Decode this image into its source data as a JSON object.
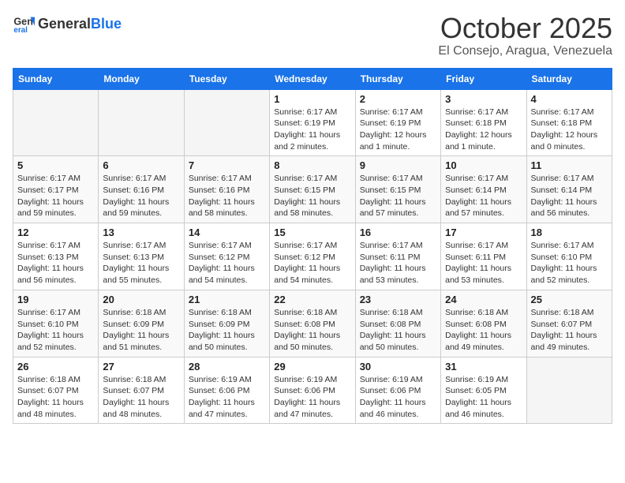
{
  "header": {
    "logo_general": "General",
    "logo_blue": "Blue",
    "month": "October 2025",
    "location": "El Consejo, Aragua, Venezuela"
  },
  "weekdays": [
    "Sunday",
    "Monday",
    "Tuesday",
    "Wednesday",
    "Thursday",
    "Friday",
    "Saturday"
  ],
  "weeks": [
    [
      {
        "day": "",
        "info": ""
      },
      {
        "day": "",
        "info": ""
      },
      {
        "day": "",
        "info": ""
      },
      {
        "day": "1",
        "info": "Sunrise: 6:17 AM\nSunset: 6:19 PM\nDaylight: 11 hours and 2 minutes."
      },
      {
        "day": "2",
        "info": "Sunrise: 6:17 AM\nSunset: 6:19 PM\nDaylight: 12 hours and 1 minute."
      },
      {
        "day": "3",
        "info": "Sunrise: 6:17 AM\nSunset: 6:18 PM\nDaylight: 12 hours and 1 minute."
      },
      {
        "day": "4",
        "info": "Sunrise: 6:17 AM\nSunset: 6:18 PM\nDaylight: 12 hours and 0 minutes."
      }
    ],
    [
      {
        "day": "5",
        "info": "Sunrise: 6:17 AM\nSunset: 6:17 PM\nDaylight: 11 hours and 59 minutes."
      },
      {
        "day": "6",
        "info": "Sunrise: 6:17 AM\nSunset: 6:16 PM\nDaylight: 11 hours and 59 minutes."
      },
      {
        "day": "7",
        "info": "Sunrise: 6:17 AM\nSunset: 6:16 PM\nDaylight: 11 hours and 58 minutes."
      },
      {
        "day": "8",
        "info": "Sunrise: 6:17 AM\nSunset: 6:15 PM\nDaylight: 11 hours and 58 minutes."
      },
      {
        "day": "9",
        "info": "Sunrise: 6:17 AM\nSunset: 6:15 PM\nDaylight: 11 hours and 57 minutes."
      },
      {
        "day": "10",
        "info": "Sunrise: 6:17 AM\nSunset: 6:14 PM\nDaylight: 11 hours and 57 minutes."
      },
      {
        "day": "11",
        "info": "Sunrise: 6:17 AM\nSunset: 6:14 PM\nDaylight: 11 hours and 56 minutes."
      }
    ],
    [
      {
        "day": "12",
        "info": "Sunrise: 6:17 AM\nSunset: 6:13 PM\nDaylight: 11 hours and 56 minutes."
      },
      {
        "day": "13",
        "info": "Sunrise: 6:17 AM\nSunset: 6:13 PM\nDaylight: 11 hours and 55 minutes."
      },
      {
        "day": "14",
        "info": "Sunrise: 6:17 AM\nSunset: 6:12 PM\nDaylight: 11 hours and 54 minutes."
      },
      {
        "day": "15",
        "info": "Sunrise: 6:17 AM\nSunset: 6:12 PM\nDaylight: 11 hours and 54 minutes."
      },
      {
        "day": "16",
        "info": "Sunrise: 6:17 AM\nSunset: 6:11 PM\nDaylight: 11 hours and 53 minutes."
      },
      {
        "day": "17",
        "info": "Sunrise: 6:17 AM\nSunset: 6:11 PM\nDaylight: 11 hours and 53 minutes."
      },
      {
        "day": "18",
        "info": "Sunrise: 6:17 AM\nSunset: 6:10 PM\nDaylight: 11 hours and 52 minutes."
      }
    ],
    [
      {
        "day": "19",
        "info": "Sunrise: 6:17 AM\nSunset: 6:10 PM\nDaylight: 11 hours and 52 minutes."
      },
      {
        "day": "20",
        "info": "Sunrise: 6:18 AM\nSunset: 6:09 PM\nDaylight: 11 hours and 51 minutes."
      },
      {
        "day": "21",
        "info": "Sunrise: 6:18 AM\nSunset: 6:09 PM\nDaylight: 11 hours and 50 minutes."
      },
      {
        "day": "22",
        "info": "Sunrise: 6:18 AM\nSunset: 6:08 PM\nDaylight: 11 hours and 50 minutes."
      },
      {
        "day": "23",
        "info": "Sunrise: 6:18 AM\nSunset: 6:08 PM\nDaylight: 11 hours and 50 minutes."
      },
      {
        "day": "24",
        "info": "Sunrise: 6:18 AM\nSunset: 6:08 PM\nDaylight: 11 hours and 49 minutes."
      },
      {
        "day": "25",
        "info": "Sunrise: 6:18 AM\nSunset: 6:07 PM\nDaylight: 11 hours and 49 minutes."
      }
    ],
    [
      {
        "day": "26",
        "info": "Sunrise: 6:18 AM\nSunset: 6:07 PM\nDaylight: 11 hours and 48 minutes."
      },
      {
        "day": "27",
        "info": "Sunrise: 6:18 AM\nSunset: 6:07 PM\nDaylight: 11 hours and 48 minutes."
      },
      {
        "day": "28",
        "info": "Sunrise: 6:19 AM\nSunset: 6:06 PM\nDaylight: 11 hours and 47 minutes."
      },
      {
        "day": "29",
        "info": "Sunrise: 6:19 AM\nSunset: 6:06 PM\nDaylight: 11 hours and 47 minutes."
      },
      {
        "day": "30",
        "info": "Sunrise: 6:19 AM\nSunset: 6:06 PM\nDaylight: 11 hours and 46 minutes."
      },
      {
        "day": "31",
        "info": "Sunrise: 6:19 AM\nSunset: 6:05 PM\nDaylight: 11 hours and 46 minutes."
      },
      {
        "day": "",
        "info": ""
      }
    ]
  ]
}
